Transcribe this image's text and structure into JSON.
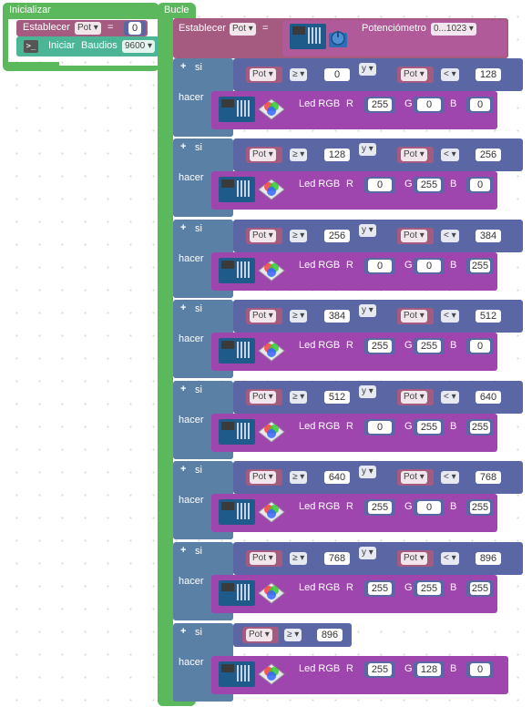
{
  "inicializar": {
    "hat_label": "Inicializar",
    "set_label": "Establecer",
    "var_name": "Pot",
    "equals": "=",
    "value": "0",
    "serial_label": "Iniciar",
    "baud_label": "Baudios",
    "baud_value": "9600"
  },
  "bucle": {
    "hat_label": "Bucle",
    "set_label": "Establecer",
    "var_name": "Pot",
    "equals": "=",
    "sensor_label": "Potenciómetro",
    "sensor_range": "0...1023"
  },
  "common": {
    "si": "si",
    "hacer": "hacer",
    "and": "y",
    "gte": "≥",
    "lt": "<",
    "led_label": "Led RGB",
    "r": "R",
    "g": "G",
    "b": "B",
    "pot": "Pot"
  },
  "rules": [
    {
      "low": "0",
      "high": "128",
      "r": "255",
      "g": "0",
      "b": "0"
    },
    {
      "low": "128",
      "high": "256",
      "r": "0",
      "g": "255",
      "b": "0"
    },
    {
      "low": "256",
      "high": "384",
      "r": "0",
      "g": "0",
      "b": "255"
    },
    {
      "low": "384",
      "high": "512",
      "r": "255",
      "g": "255",
      "b": "0"
    },
    {
      "low": "512",
      "high": "640",
      "r": "0",
      "g": "255",
      "b": "255"
    },
    {
      "low": "640",
      "high": "768",
      "r": "255",
      "g": "0",
      "b": "255"
    },
    {
      "low": "768",
      "high": "896",
      "r": "255",
      "g": "255",
      "b": "255"
    },
    {
      "low": "896",
      "high": "",
      "r": "255",
      "g": "128",
      "b": "0"
    }
  ],
  "colors": {
    "event_green": "#5cb85c",
    "variable": "#a55b80",
    "logic": "#5b80a5",
    "compare": "#5b67a5",
    "led": "#9f46ae",
    "serial": "#4bb596"
  }
}
